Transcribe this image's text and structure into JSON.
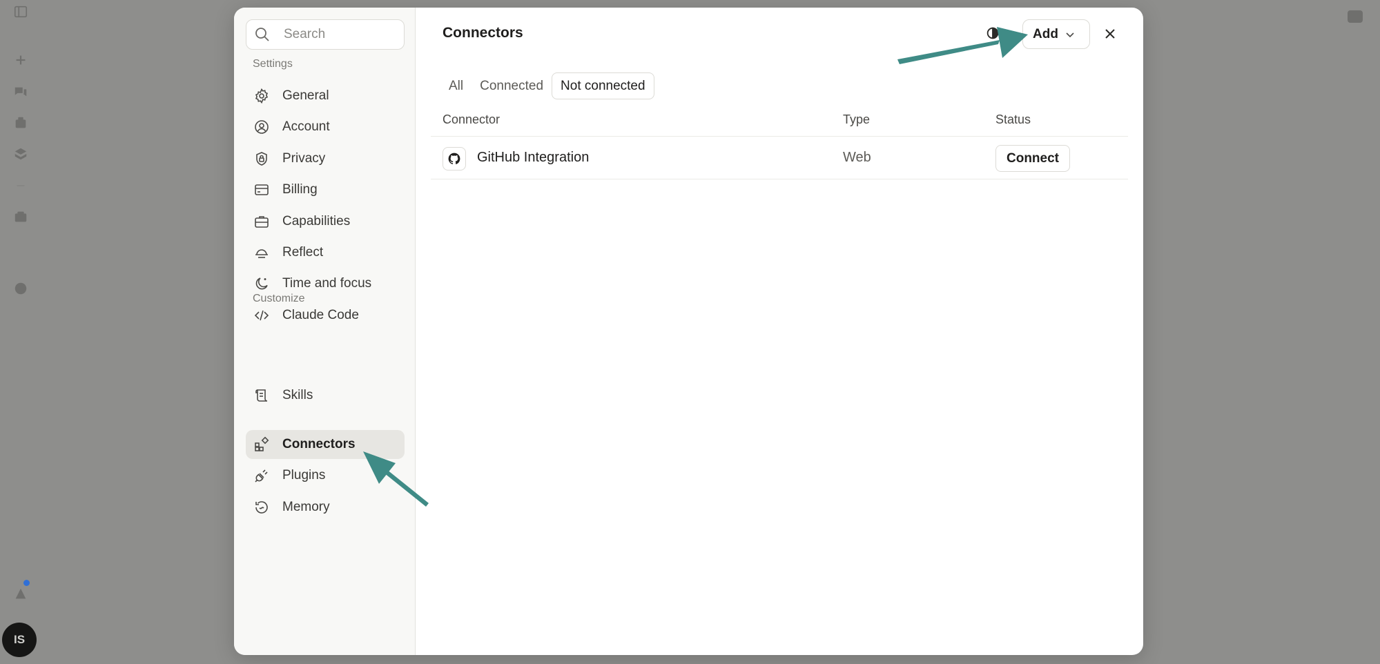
{
  "search": {
    "placeholder": "Search"
  },
  "sidebar": {
    "settings_label": "Settings",
    "settings_items": [
      {
        "label": "General",
        "icon": "gear-icon"
      },
      {
        "label": "Account",
        "icon": "user-circle-icon"
      },
      {
        "label": "Privacy",
        "icon": "shield-lock-icon"
      },
      {
        "label": "Billing",
        "icon": "credit-card-icon"
      },
      {
        "label": "Capabilities",
        "icon": "briefcase-icon"
      },
      {
        "label": "Reflect",
        "icon": "reflect-icon"
      },
      {
        "label": "Time and focus",
        "icon": "moon-icon"
      },
      {
        "label": "Claude Code",
        "icon": "code-icon"
      }
    ],
    "customize_label": "Customize",
    "customize_items": [
      {
        "label": "Skills",
        "icon": "scroll-icon"
      },
      {
        "label": "Connectors",
        "icon": "connectors-icon",
        "active": true
      },
      {
        "label": "Plugins",
        "icon": "plug-icon"
      },
      {
        "label": "Memory",
        "icon": "memory-icon"
      }
    ]
  },
  "main": {
    "title": "Connectors",
    "add_label": "Add",
    "tabs": [
      {
        "label": "All"
      },
      {
        "label": "Connected"
      },
      {
        "label": "Not connected",
        "selected": true
      }
    ],
    "table": {
      "headers": {
        "connector": "Connector",
        "type": "Type",
        "status": "Status"
      },
      "rows": [
        {
          "name": "GitHub Integration",
          "type": "Web",
          "action": "Connect",
          "icon": "github-icon"
        }
      ]
    }
  },
  "rail": {
    "avatar_initials": "IS"
  },
  "colors": {
    "accent_arrow": "#3f8b86",
    "backdrop": "#8e8e8c",
    "active_item": "#e7e6e2"
  }
}
